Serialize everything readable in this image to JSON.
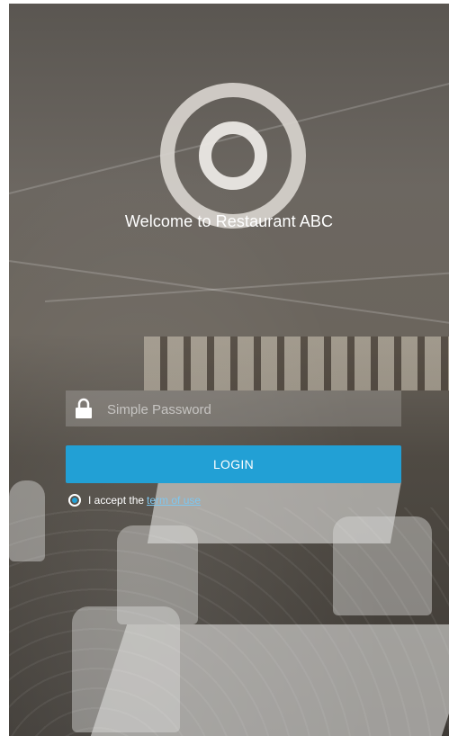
{
  "welcome_title": "Welcome to Restaurant ABC",
  "password": {
    "placeholder": "Simple Password",
    "value": ""
  },
  "login_button_label": "LOGIN",
  "terms": {
    "prefix": "I accept the",
    "link_label": "term of use",
    "accepted": true
  },
  "colors": {
    "accent": "#22a0d5",
    "link": "#7ec7f0",
    "text": "#ffffff"
  },
  "icons": {
    "logo": "target-ring-logo",
    "lock": "lock-icon"
  }
}
